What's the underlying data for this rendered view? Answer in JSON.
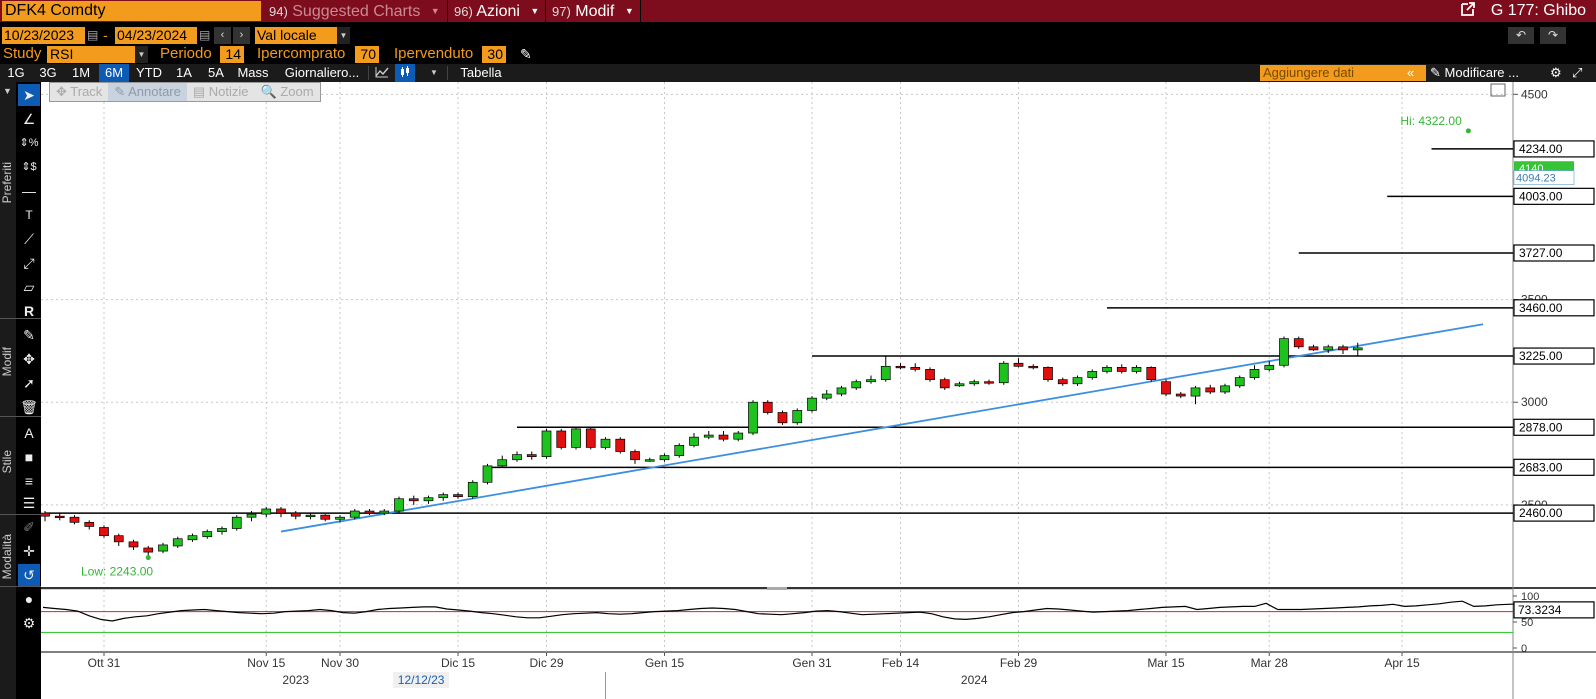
{
  "topbar": {
    "security": "DFK4 Comdty",
    "menu_suggested": "Suggested Charts",
    "menu_suggested_num": "94)",
    "menu_azioni": "Azioni",
    "menu_azioni_num": "96)",
    "menu_modif": "Modif",
    "menu_modif_num": "97)",
    "right_label": "G 177: Ghibo"
  },
  "row2": {
    "date_from": "10/23/2023",
    "date_to": "04/23/2024",
    "date_sep": "-",
    "currency": "Val locale"
  },
  "row3": {
    "study_label": "Study",
    "study_value": "RSI",
    "periodo_label": "Periodo",
    "periodo_value": "14",
    "ipercomprato_label": "Ipercomprato",
    "ipercomprato_value": "70",
    "ipervenduto_label": "Ipervenduto",
    "ipervenduto_value": "30"
  },
  "row4": {
    "timeframes": [
      "1G",
      "3G",
      "1M",
      "6M",
      "YTD",
      "1A",
      "5A",
      "Mass"
    ],
    "active_timeframe": "6M",
    "period": "Giornaliero...",
    "tabella": "Tabella",
    "add_data_placeholder": "Aggiungere dati",
    "modifica": "Modificare ..."
  },
  "annotate_bar": {
    "track": "Track",
    "annotare": "Annotare",
    "notizie": "Notizie",
    "zoom": "Zoom"
  },
  "left_groups": {
    "preferiti": "Preferiti",
    "modif": "Modif",
    "stile": "Stile",
    "modalita": "Modalità"
  },
  "colors": {
    "up": "#1fc11f",
    "down": "#e01010",
    "trendline": "#3d8fe0",
    "hi_low_label": "#35b535",
    "rsi_line": "#000000",
    "rsi_upper": "#e02020",
    "rsi_lower": "#20c020",
    "brand_orange": "#f29b1d",
    "topbar": "#7d0c1c"
  },
  "chart_data": {
    "type": "candlestick",
    "y_ticks": [
      "4500",
      "3500",
      "3000",
      "2500"
    ],
    "ylim": [
      2100,
      4560
    ],
    "hi_label": "Hi: 4322.00",
    "hi_value": 4322.0,
    "low_label": "Low: 2243.00",
    "low_value": 2243.0,
    "last_price": "4094.23",
    "last_value": 4094.23,
    "hidden_price": "4140",
    "hidden_price_value": 4140,
    "levels": [
      {
        "label": "4234.00",
        "value": 4234,
        "start_index": 94
      },
      {
        "label": "4003.00",
        "value": 4003,
        "start_index": 91
      },
      {
        "label": "3727.00",
        "value": 3727,
        "start_index": 85
      },
      {
        "label": "3460.00",
        "value": 3460,
        "start_index": 72
      },
      {
        "label": "3225.00",
        "value": 3225,
        "start_index": 52
      },
      {
        "label": "2878.00",
        "value": 2878,
        "start_index": 32
      },
      {
        "label": "2683.00",
        "value": 2683,
        "start_index": 30
      },
      {
        "label": "2460.00",
        "value": 2460,
        "start_index": 0
      }
    ],
    "trendline": [
      {
        "index": 16,
        "value": 2370
      },
      {
        "index": 97.5,
        "value": 3380
      }
    ],
    "x_labels": [
      "Ott 31",
      "Nov 15",
      "Nov 30",
      "Dic 15",
      "Dic 29",
      "Gen 15",
      "Gen 31",
      "Feb 14",
      "Feb 29",
      "Mar 15",
      "Mar 28",
      "Apr 15"
    ],
    "x_label_index": [
      4,
      15,
      20,
      28,
      34,
      42,
      52,
      58,
      66,
      76,
      83,
      92
    ],
    "year_labels": [
      "2023",
      "2024"
    ],
    "year_label_index": [
      17,
      63
    ],
    "crosshair_date": "12/12/23",
    "crosshair_index": 25.5,
    "candles": [
      [
        2460,
        2445,
        2470,
        2420
      ],
      [
        2445,
        2440,
        2460,
        2425
      ],
      [
        2440,
        2415,
        2450,
        2405
      ],
      [
        2415,
        2395,
        2425,
        2380
      ],
      [
        2390,
        2350,
        2400,
        2340
      ],
      [
        2350,
        2320,
        2360,
        2300
      ],
      [
        2320,
        2295,
        2330,
        2280
      ],
      [
        2290,
        2270,
        2300,
        2243
      ],
      [
        2275,
        2305,
        2315,
        2265
      ],
      [
        2300,
        2335,
        2345,
        2290
      ],
      [
        2330,
        2350,
        2360,
        2320
      ],
      [
        2345,
        2370,
        2380,
        2335
      ],
      [
        2370,
        2385,
        2395,
        2355
      ],
      [
        2385,
        2440,
        2450,
        2375
      ],
      [
        2440,
        2455,
        2470,
        2420
      ],
      [
        2455,
        2480,
        2490,
        2440
      ],
      [
        2480,
        2460,
        2490,
        2440
      ],
      [
        2460,
        2445,
        2470,
        2430
      ],
      [
        2445,
        2450,
        2460,
        2430
      ],
      [
        2450,
        2430,
        2455,
        2420
      ],
      [
        2430,
        2440,
        2450,
        2415
      ],
      [
        2440,
        2470,
        2480,
        2430
      ],
      [
        2470,
        2460,
        2480,
        2450
      ],
      [
        2460,
        2470,
        2480,
        2450
      ],
      [
        2470,
        2530,
        2540,
        2460
      ],
      [
        2530,
        2520,
        2545,
        2500
      ],
      [
        2520,
        2535,
        2545,
        2505
      ],
      [
        2535,
        2550,
        2560,
        2520
      ],
      [
        2550,
        2540,
        2560,
        2530
      ],
      [
        2540,
        2610,
        2620,
        2530
      ],
      [
        2610,
        2690,
        2700,
        2600
      ],
      [
        2690,
        2720,
        2740,
        2680
      ],
      [
        2720,
        2745,
        2760,
        2710
      ],
      [
        2745,
        2735,
        2760,
        2720
      ],
      [
        2735,
        2860,
        2870,
        2725
      ],
      [
        2860,
        2780,
        2870,
        2770
      ],
      [
        2780,
        2870,
        2880,
        2770
      ],
      [
        2870,
        2780,
        2880,
        2770
      ],
      [
        2780,
        2820,
        2830,
        2770
      ],
      [
        2820,
        2760,
        2830,
        2750
      ],
      [
        2760,
        2720,
        2770,
        2700
      ],
      [
        2720,
        2720,
        2730,
        2710
      ],
      [
        2720,
        2740,
        2750,
        2710
      ],
      [
        2740,
        2790,
        2800,
        2730
      ],
      [
        2790,
        2830,
        2850,
        2780
      ],
      [
        2830,
        2840,
        2860,
        2820
      ],
      [
        2840,
        2820,
        2860,
        2810
      ],
      [
        2820,
        2850,
        2860,
        2810
      ],
      [
        2850,
        3000,
        3010,
        2840
      ],
      [
        3000,
        2950,
        3010,
        2940
      ],
      [
        2950,
        2900,
        2960,
        2890
      ],
      [
        2900,
        2960,
        2970,
        2890
      ],
      [
        2960,
        3020,
        3030,
        2950
      ],
      [
        3020,
        3040,
        3060,
        3010
      ],
      [
        3040,
        3070,
        3080,
        3030
      ],
      [
        3070,
        3100,
        3110,
        3060
      ],
      [
        3100,
        3110,
        3130,
        3090
      ],
      [
        3110,
        3175,
        3225,
        3100
      ],
      [
        3175,
        3170,
        3190,
        3160
      ],
      [
        3170,
        3160,
        3190,
        3150
      ],
      [
        3160,
        3110,
        3170,
        3100
      ],
      [
        3110,
        3070,
        3120,
        3060
      ],
      [
        3080,
        3090,
        3100,
        3075
      ],
      [
        3090,
        3100,
        3110,
        3080
      ],
      [
        3100,
        3095,
        3110,
        3085
      ],
      [
        3095,
        3190,
        3200,
        3085
      ],
      [
        3190,
        3175,
        3215,
        3170
      ],
      [
        3175,
        3170,
        3185,
        3160
      ],
      [
        3170,
        3110,
        3175,
        3100
      ],
      [
        3110,
        3090,
        3120,
        3080
      ],
      [
        3090,
        3120,
        3130,
        3080
      ],
      [
        3120,
        3150,
        3160,
        3110
      ],
      [
        3150,
        3170,
        3180,
        3140
      ],
      [
        3170,
        3150,
        3185,
        3140
      ],
      [
        3150,
        3170,
        3180,
        3140
      ],
      [
        3170,
        3110,
        3175,
        3100
      ],
      [
        3100,
        3040,
        3110,
        3030
      ],
      [
        3040,
        3030,
        3050,
        3020
      ],
      [
        3030,
        3070,
        3080,
        2990
      ],
      [
        3070,
        3050,
        3085,
        3040
      ],
      [
        3050,
        3080,
        3090,
        3040
      ],
      [
        3080,
        3120,
        3130,
        3070
      ],
      [
        3120,
        3160,
        3180,
        3110
      ],
      [
        3160,
        3180,
        3200,
        3150
      ],
      [
        3180,
        3310,
        3320,
        3170
      ],
      [
        3310,
        3270,
        3320,
        3260
      ],
      [
        3270,
        3255,
        3280,
        3250
      ],
      [
        3255,
        3270,
        3280,
        3240
      ],
      [
        3270,
        3255,
        3280,
        3235
      ],
      [
        3255,
        3265,
        3290,
        3225
      ]
    ]
  },
  "rsi": {
    "value_label": "73.3234",
    "value": 73.3234,
    "ticks": [
      "100",
      "50",
      "0"
    ],
    "overbought": 70,
    "oversold": 30,
    "values": [
      78,
      76,
      74,
      71,
      62,
      55,
      52,
      57,
      60,
      62,
      66,
      69,
      72,
      73,
      74,
      72,
      70,
      68,
      67,
      66,
      67,
      70,
      71,
      72,
      74,
      72,
      68,
      67,
      70,
      74,
      76,
      77,
      78,
      79,
      79,
      75,
      73,
      71,
      68,
      66,
      63,
      60,
      58,
      58,
      61,
      64,
      66,
      67,
      68,
      66,
      65,
      66,
      68,
      70,
      71,
      72,
      74,
      76,
      77,
      76,
      74,
      70,
      66,
      65,
      64,
      66,
      68,
      71,
      72,
      70,
      67,
      64,
      65,
      66,
      67,
      68,
      69,
      66,
      60,
      56,
      55,
      57,
      60,
      64,
      68,
      70,
      73,
      76,
      75,
      73,
      71,
      69,
      70,
      71,
      72,
      74,
      76,
      78,
      79,
      80,
      74,
      76,
      78,
      79,
      80,
      80,
      86,
      74,
      74,
      74,
      75,
      76,
      77,
      78,
      79,
      81,
      82,
      84,
      80,
      81,
      83,
      85,
      88,
      90,
      80,
      81,
      83,
      84,
      85
    ]
  }
}
